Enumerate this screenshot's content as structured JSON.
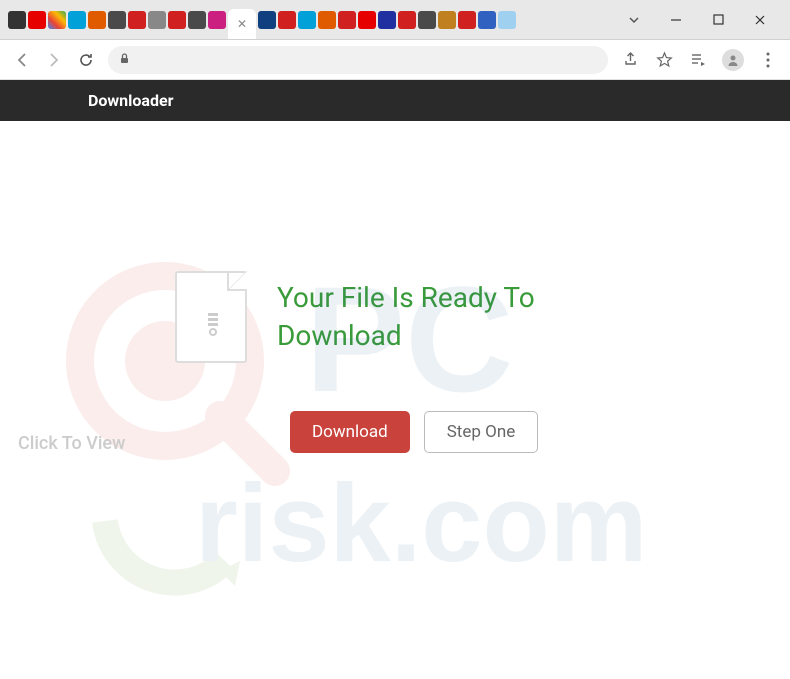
{
  "window": {
    "tabs": [
      {
        "color": "#333"
      },
      {
        "color": "#e60000"
      },
      {
        "color": "#4285f4"
      },
      {
        "color": "#00a0d8"
      },
      {
        "color": "#e05a00"
      },
      {
        "color": "#4a4a4a"
      },
      {
        "color": "#d02020"
      },
      {
        "color": "#888"
      },
      {
        "color": "#d02020"
      },
      {
        "color": "#4a4a4a"
      },
      {
        "color": "#cc2080"
      },
      {
        "active": true
      },
      {
        "color": "#104080"
      },
      {
        "color": "#d02020"
      },
      {
        "color": "#00a0d8"
      },
      {
        "color": "#e05a00"
      },
      {
        "color": "#d02020"
      },
      {
        "color": "#e60000"
      },
      {
        "color": "#2030a0"
      },
      {
        "color": "#d02020"
      },
      {
        "color": "#4a4a4a"
      },
      {
        "color": "#c08020"
      },
      {
        "color": "#d02020"
      },
      {
        "color": "#3060c0"
      },
      {
        "color": "#a0d0f0"
      }
    ]
  },
  "page": {
    "header_title": "Downloader",
    "heading": "Your File Is Ready To Download",
    "download_label": "Download",
    "step_label": "Step One"
  },
  "watermark": {
    "click_text": "Click To View",
    "brand_top": "PC",
    "brand_bottom": "risk.com"
  }
}
